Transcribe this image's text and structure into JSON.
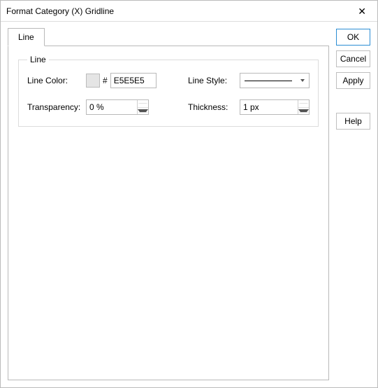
{
  "window": {
    "title": "Format Category (X) Gridline"
  },
  "tabs": [
    {
      "label": "Line"
    }
  ],
  "group": {
    "legend": "Line"
  },
  "fields": {
    "line_color_label": "Line Color:",
    "hash": "#",
    "hex_value": "E5E5E5",
    "line_style_label": "Line Style:",
    "transparency_label": "Transparency:",
    "transparency_value": "0 %",
    "thickness_label": "Thickness:",
    "thickness_value": "1 px"
  },
  "buttons": {
    "ok": "OK",
    "cancel": "Cancel",
    "apply": "Apply",
    "help": "Help"
  },
  "colors": {
    "swatch": "#E5E5E5"
  }
}
